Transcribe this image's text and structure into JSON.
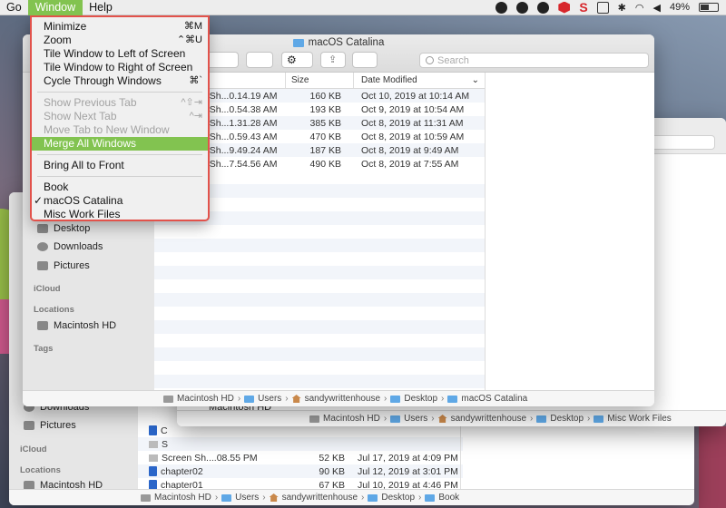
{
  "menubar": {
    "items": [
      "Go",
      "Window",
      "Help"
    ],
    "battery": "49%"
  },
  "window_menu": {
    "items": [
      {
        "label": "Minimize",
        "shortcut": "⌘M"
      },
      {
        "label": "Zoom",
        "shortcut": "⌃⌘U"
      },
      {
        "label": "Tile Window to Left of Screen",
        "shortcut": ""
      },
      {
        "label": "Tile Window to Right of Screen",
        "shortcut": ""
      },
      {
        "label": "Cycle Through Windows",
        "shortcut": "⌘`"
      },
      {
        "label": "Show Previous Tab",
        "shortcut": "^⇧⇥"
      },
      {
        "label": "Show Next Tab",
        "shortcut": "^⇥"
      },
      {
        "label": "Move Tab to New Window",
        "shortcut": ""
      },
      {
        "label": "Merge All Windows",
        "shortcut": ""
      },
      {
        "label": "Bring All to Front",
        "shortcut": ""
      },
      {
        "label": "Book",
        "shortcut": ""
      },
      {
        "label": "macOS Catalina",
        "shortcut": ""
      },
      {
        "label": "Misc Work Files",
        "shortcut": ""
      }
    ]
  },
  "front_window": {
    "title": "macOS Catalina",
    "search_placeholder": "Search",
    "columns": {
      "size": "Size",
      "date": "Date Modified"
    },
    "rows": [
      {
        "name": "n Sh...0.14.19 AM",
        "size": "160 KB",
        "date": "Oct 10, 2019 at 10:14 AM"
      },
      {
        "name": "n Sh...0.54.38 AM",
        "size": "193 KB",
        "date": "Oct 9, 2019 at 10:54 AM"
      },
      {
        "name": "n Sh...1.31.28 AM",
        "size": "385 KB",
        "date": "Oct 8, 2019 at 11:31 AM"
      },
      {
        "name": "n Sh...0.59.43 AM",
        "size": "470 KB",
        "date": "Oct 8, 2019 at 10:59 AM"
      },
      {
        "name": "n Sh...9.49.24 AM",
        "size": "187 KB",
        "date": "Oct 8, 2019 at 9:49 AM"
      },
      {
        "name": "n Sh...7.54.56 AM",
        "size": "490 KB",
        "date": "Oct 8, 2019 at 7:55 AM"
      }
    ],
    "sidebar": {
      "favorites": [
        "Desktop",
        "Downloads",
        "Pictures"
      ],
      "icloud_head": "iCloud",
      "locations_head": "Locations",
      "locations": [
        "Macintosh HD"
      ],
      "tags_head": "Tags"
    },
    "path": [
      "Macintosh HD",
      "Users",
      "sandywrittenhouse",
      "Desktop",
      "macOS Catalina"
    ]
  },
  "misc_window": {
    "path": [
      "Macintosh HD",
      "Users",
      "sandywrittenhouse",
      "Desktop",
      "Misc Work Files"
    ],
    "visible_item": "Macintosh HD"
  },
  "book_window": {
    "sidebar": {
      "favorites": [
        "Downloads",
        "Pictures"
      ],
      "icloud_head": "iCloud",
      "locations_head": "Locations",
      "locations": [
        "Macintosh HD"
      ]
    },
    "rows": [
      {
        "name": "C",
        "size": "",
        "date": ""
      },
      {
        "name": "S",
        "size": "",
        "date": ""
      },
      {
        "name": "Screen Sh....08.55 PM",
        "size": "52 KB",
        "date": "Jul 17, 2019 at 4:09 PM"
      },
      {
        "name": "chapter02",
        "size": "90 KB",
        "date": "Jul 12, 2019 at 3:01 PM"
      },
      {
        "name": "chapter01",
        "size": "67 KB",
        "date": "Jul 10, 2019 at 4:46 PM"
      }
    ],
    "path": [
      "Macintosh HD",
      "Users",
      "sandywrittenhouse",
      "Desktop",
      "Book"
    ]
  }
}
